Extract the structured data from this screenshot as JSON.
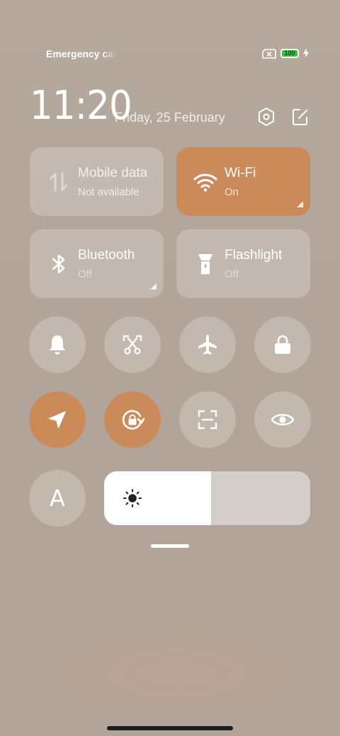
{
  "status": {
    "carrier": "Emergency calls",
    "battery_text": "100",
    "battery_level_percent": 100
  },
  "header": {
    "time": "11:20",
    "date": "Friday, 25 February",
    "settings_icon": "hexagon-settings-icon",
    "edit_icon": "edit-icon"
  },
  "tiles": [
    {
      "label": "Mobile data",
      "sub": "Not available",
      "icon": "mobile-data-icon",
      "active": false
    },
    {
      "label": "Wi-Fi",
      "sub": "On",
      "icon": "wifi-icon",
      "active": true
    },
    {
      "label": "Bluetooth",
      "sub": "Off",
      "icon": "bluetooth-icon",
      "active": false
    },
    {
      "label": "Flashlight",
      "sub": "Off",
      "icon": "flashlight-icon",
      "active": false
    }
  ],
  "toggles_row1": [
    "bell-icon",
    "screenshot-icon",
    "airplane-icon",
    "lock-icon"
  ],
  "toggles_row2": [
    "location-icon",
    "rotation-lock-icon",
    "scanner-icon",
    "eye-icon"
  ],
  "toggles_active": [
    "location-icon",
    "rotation-lock-icon"
  ],
  "auto_brightness_label": "A",
  "brightness": {
    "level_percent": 52,
    "icon": "sun-icon"
  },
  "colors": {
    "accent": "#cb8a5a",
    "tile_inactive": "rgba(255,255,255,0.22)",
    "battery_green": "#35c23b"
  }
}
